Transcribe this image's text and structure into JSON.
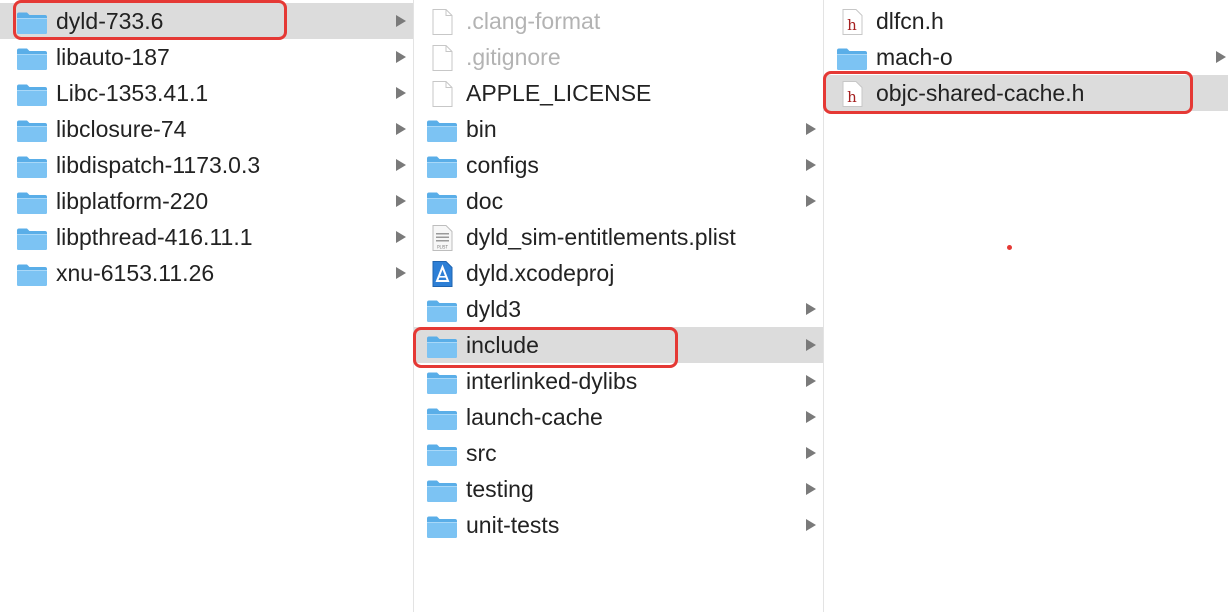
{
  "columns": [
    {
      "items": [
        {
          "label": "dyld-733.6",
          "type": "folder",
          "selected": true,
          "chevron": true
        },
        {
          "label": "libauto-187",
          "type": "folder",
          "chevron": true
        },
        {
          "label": "Libc-1353.41.1",
          "type": "folder",
          "chevron": true
        },
        {
          "label": "libclosure-74",
          "type": "folder",
          "chevron": true
        },
        {
          "label": "libdispatch-1173.0.3",
          "type": "folder",
          "chevron": true
        },
        {
          "label": "libplatform-220",
          "type": "folder",
          "chevron": true
        },
        {
          "label": "libpthread-416.11.1",
          "type": "folder",
          "chevron": true
        },
        {
          "label": "xnu-6153.11.26",
          "type": "folder",
          "chevron": true
        }
      ]
    },
    {
      "items": [
        {
          "label": ".clang-format",
          "type": "file",
          "dim": true
        },
        {
          "label": ".gitignore",
          "type": "file",
          "dim": true
        },
        {
          "label": "APPLE_LICENSE",
          "type": "file"
        },
        {
          "label": "bin",
          "type": "folder",
          "chevron": true
        },
        {
          "label": "configs",
          "type": "folder",
          "chevron": true
        },
        {
          "label": "doc",
          "type": "folder",
          "chevron": true
        },
        {
          "label": "dyld_sim-entitlements.plist",
          "type": "plist",
          "icon_text": "PLIST"
        },
        {
          "label": "dyld.xcodeproj",
          "type": "xcodeproj"
        },
        {
          "label": "dyld3",
          "type": "folder",
          "chevron": true
        },
        {
          "label": "include",
          "type": "folder",
          "selected": true,
          "chevron": true
        },
        {
          "label": "interlinked-dylibs",
          "type": "folder",
          "chevron": true
        },
        {
          "label": "launch-cache",
          "type": "folder",
          "chevron": true
        },
        {
          "label": "src",
          "type": "folder",
          "chevron": true
        },
        {
          "label": "testing",
          "type": "folder",
          "chevron": true
        },
        {
          "label": "unit-tests",
          "type": "folder",
          "chevron": true
        }
      ]
    },
    {
      "items": [
        {
          "label": "dlfcn.h",
          "type": "header",
          "icon_text": "h"
        },
        {
          "label": "mach-o",
          "type": "folder",
          "chevron": true
        },
        {
          "label": "objc-shared-cache.h",
          "type": "header",
          "icon_text": "h",
          "selected": true
        }
      ]
    }
  ],
  "colors": {
    "highlight": "#e53935",
    "selection": "#dcdcdc",
    "folder": "#6fb8ee"
  }
}
